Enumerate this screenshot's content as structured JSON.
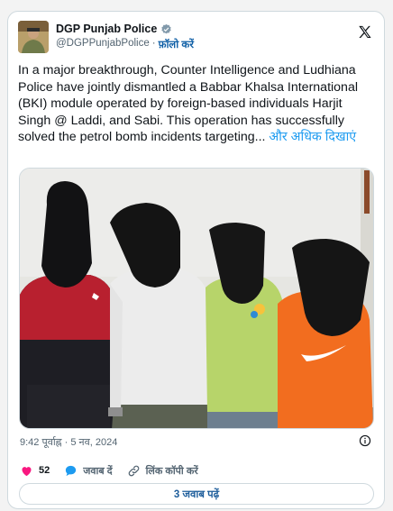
{
  "author": {
    "display_name": "DGP Punjab Police",
    "handle": "@DGPPunjabPolice",
    "separator": "·",
    "follow_label": "फ़ॉलो करें"
  },
  "tweet": {
    "text": "In a major breakthrough, Counter Intelligence and Ludhiana Police have jointly dismantled a Babbar Khalsa International (BKI) module operated by foreign-based individuals Harjit Singh @ Laddi, and Sabi. This operation has successfully solved the petrol bomb incidents targeting...",
    "read_more": "और अधिक दिखाएं"
  },
  "meta": {
    "time": "9:42 पूर्वाह्न",
    "separator": "·",
    "date": "5 नव, 2024"
  },
  "actions": {
    "likes": "52",
    "reply_label": "जवाब दें",
    "copy_link_label": "लिंक कॉपी करें"
  },
  "replies_button": "3 जवाब पढ़ें",
  "colors": {
    "like": "#f91880",
    "reply_bubble": "#1d9bf0",
    "verified": "#829aab",
    "link": "#1d9bf0"
  },
  "icons": [
    "verified-badge-icon",
    "x-logo-icon",
    "info-icon",
    "heart-icon",
    "reply-bubble-icon",
    "link-icon"
  ]
}
